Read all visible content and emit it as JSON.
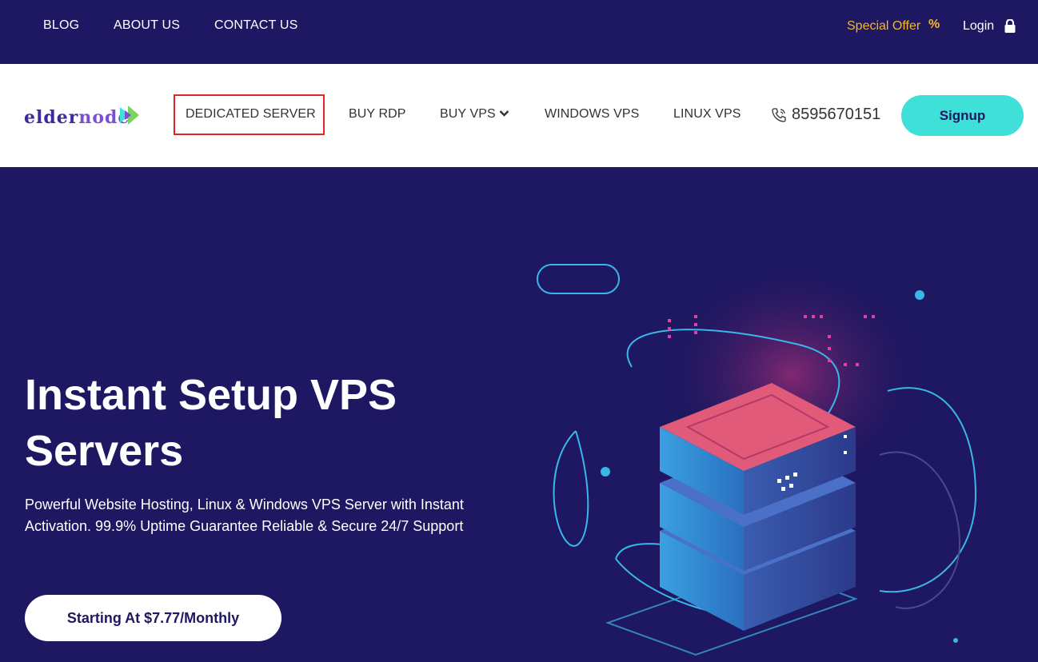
{
  "topbar": {
    "links": [
      "BLOG",
      "ABOUT US",
      "CONTACT US"
    ],
    "special_offer": "Special Offer",
    "special_icon": "percent-icon",
    "login": "Login",
    "login_icon": "lock-icon"
  },
  "nav": {
    "logo": {
      "part1": "elder",
      "part2": "node"
    },
    "items": [
      "DEDICATED SERVER",
      "BUY RDP",
      "BUY VPS",
      "WINDOWS VPS",
      "LINUX VPS"
    ],
    "highlighted_item": "DEDICATED SERVER",
    "phone": "8595670151",
    "signup": "Signup"
  },
  "hero": {
    "title_line1": "Instant Setup VPS",
    "title_line2": "Servers",
    "subtitle_line1": "Powerful Website Hosting, Linux & Windows VPS Server with Instant",
    "subtitle_line2": "Activation. 99.9% Uptime Guarantee Reliable & Secure 24/7 Support",
    "cta": "Starting At $7.77/Monthly",
    "illustration": "server-stack-illustration"
  },
  "colors": {
    "background": "#1e1761",
    "accent": "#3ee0d8",
    "special_offer": "#f5b82e",
    "highlight_border": "#e3222a"
  }
}
